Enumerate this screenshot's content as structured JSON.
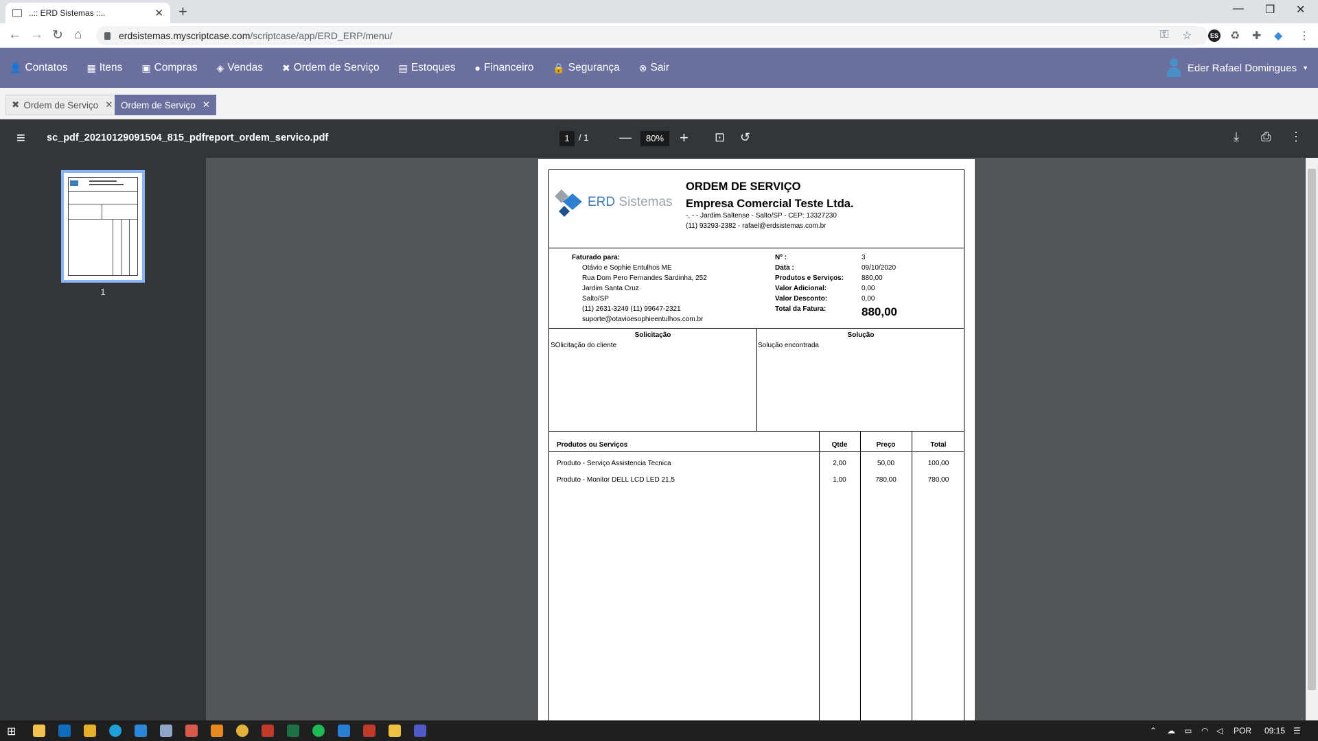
{
  "browser": {
    "tab_title": "..:: ERD Sistemas ::..",
    "url_host": "erdsistemas.myscriptcase.com",
    "url_path": "/scriptcase/app/ERD_ERP/menu/"
  },
  "appnav": {
    "items": [
      "Contatos",
      "Itens",
      "Compras",
      "Vendas",
      "Ordem de Serviço",
      "Estoques",
      "Financeiro",
      "Segurança",
      "Sair"
    ],
    "user": "Eder Rafael Domingues"
  },
  "apptabs": [
    "Ordem de Serviço",
    "Ordem de Serviço"
  ],
  "pdf": {
    "filename": "sc_pdf_20210129091504_815_pdfreport_ordem_servico.pdf",
    "page": "1",
    "page_total": "1",
    "zoom": "80%",
    "thumb_label": "1"
  },
  "doc": {
    "logo_erd": "ERD",
    "logo_sistemas": "Sistemas",
    "title": "ORDEM DE SERVIÇO",
    "company": "Empresa Comercial Teste Ltda.",
    "address": "-, - - Jardim Saltense - Salto/SP - CEP: 13327230",
    "contact": "(11) 93293-2382 - rafael@erdsistemas.com.br",
    "billed_label": "Faturado para:",
    "customer_lines": [
      "Otávio e Sophie Entulhos ME",
      "Rua Dom Pero Fernandes Sardinha, 252",
      "Jardim Santa Cruz",
      "Salto/SP",
      "(11) 2631-3249 (11) 99647-2321",
      "suporte@otavioesophieentulhos.com.br"
    ],
    "num_label": "Nº :",
    "num": "3",
    "date_label": "Data :",
    "date": "09/10/2020",
    "prod_label": "Produtos e Serviços:",
    "prod": "880,00",
    "add_label": "Valor Adicional:",
    "add": "0,00",
    "disc_label": "Valor Desconto:",
    "disc": "0,00",
    "total_label": "Total da Fatura:",
    "total": "880,00",
    "req_title": "Solicitação",
    "req_text": "SOlicitação do cliente",
    "sol_title": "Solução",
    "sol_text": "Solução encontrada",
    "table_headers": [
      "Produtos ou Serviços",
      "Qtde",
      "Preço",
      "Total"
    ],
    "rows": [
      [
        "Produto - Serviço Assistencia Tecnica",
        "2,00",
        "50,00",
        "100,00"
      ],
      [
        "Produto - Monitor DELL LCD LED 21,5",
        "1,00",
        "780,00",
        "780,00"
      ]
    ]
  },
  "taskbar": {
    "lang": "POR",
    "time": "09:15"
  }
}
